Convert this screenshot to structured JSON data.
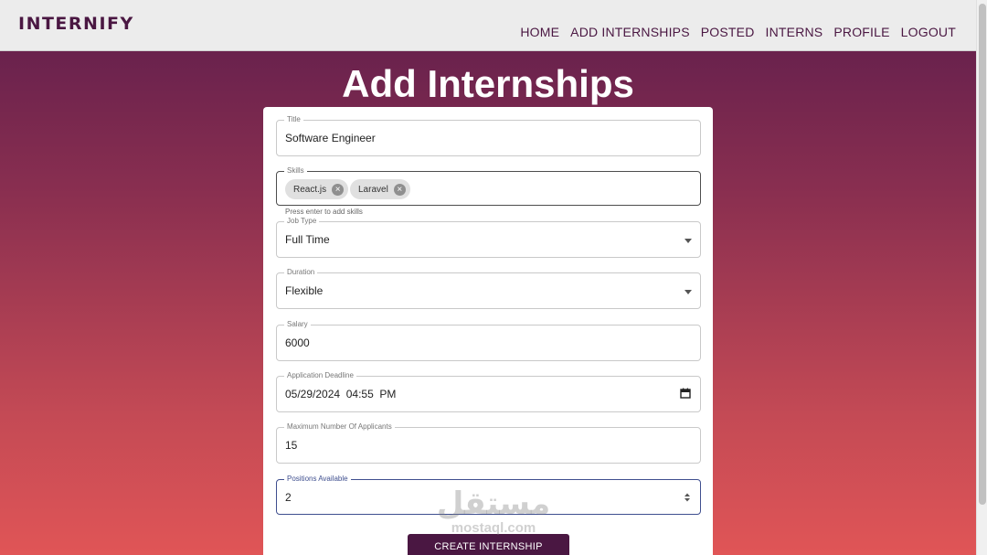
{
  "brand": {
    "name": "INTERNIFY"
  },
  "nav": {
    "items": [
      "HOME",
      "ADD INTERNSHIPS",
      "POSTED",
      "INTERNS",
      "PROFILE",
      "LOGOUT"
    ]
  },
  "page": {
    "title": "Add Internships"
  },
  "form": {
    "title": {
      "label": "Title",
      "value": "Software Engineer"
    },
    "skills": {
      "label": "Skills",
      "chips": [
        "React.js",
        "Laravel"
      ],
      "helper": "Press enter to add skills"
    },
    "job_type": {
      "label": "Job Type",
      "value": "Full Time"
    },
    "duration": {
      "label": "Duration",
      "value": "Flexible"
    },
    "salary": {
      "label": "Salary",
      "value": "6000"
    },
    "deadline": {
      "label": "Application Deadline",
      "value": "05/29/2024  04:55  PM"
    },
    "max_applicants": {
      "label": "Maximum Number Of Applicants",
      "value": "15"
    },
    "positions": {
      "label": "Positions Available",
      "value": "2"
    },
    "submit_label": "CREATE INTERNSHIP"
  },
  "watermark": {
    "arabic": "مستقل",
    "latin": "mostaql.com"
  },
  "colors": {
    "brand": "#4a1742",
    "focus": "#3f4f8f",
    "gradient_top": "#5e1d4c",
    "gradient_bottom": "#e05556"
  },
  "icons": {
    "dropdown": "arrow-drop-down-icon",
    "calendar": "calendar-icon",
    "chip_delete": "cancel-circle-icon",
    "stepper": "number-stepper-icon"
  }
}
